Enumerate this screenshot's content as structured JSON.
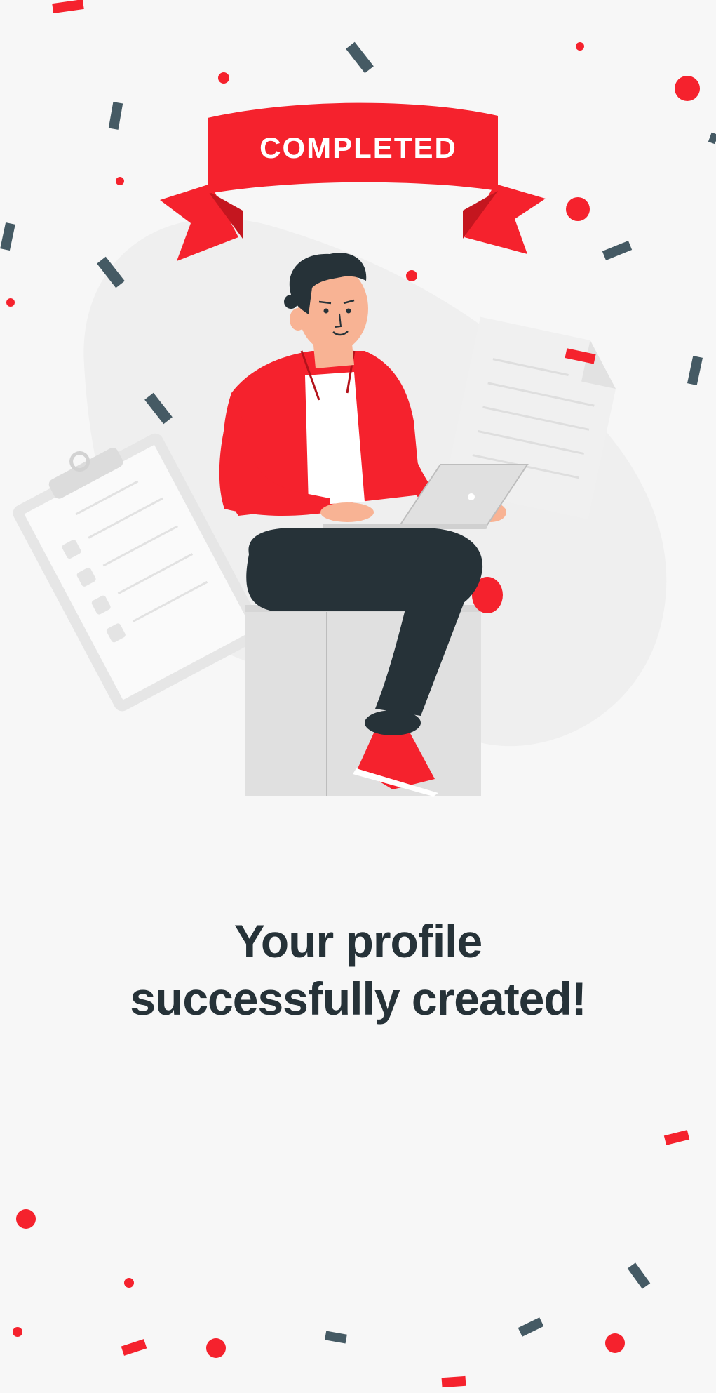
{
  "banner": {
    "text": "COMPLETED"
  },
  "message": {
    "line1": "Your profile",
    "line2": "successfully created!"
  },
  "colors": {
    "accent": "#f5222d",
    "dark": "#263238",
    "slate": "#455a64",
    "background": "#f7f7f7",
    "muted": "#e0e0e0"
  },
  "icons": [
    "confetti",
    "ribbon-banner",
    "clipboard-checklist",
    "document",
    "laptop",
    "person-illustration"
  ]
}
